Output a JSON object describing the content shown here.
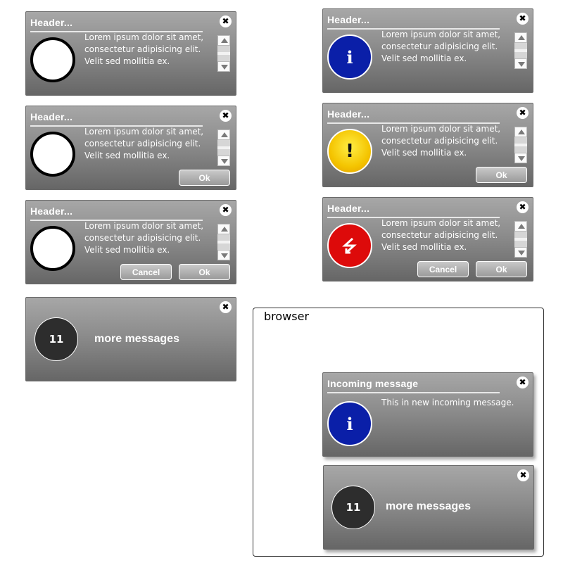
{
  "dialogs": {
    "header": "Header...",
    "close_glyph": "✖",
    "body_lines": [
      "Lorem ipsum dolor sit amet,",
      "consectetur adipisicing elit.",
      "Velit sed mollitia ex."
    ],
    "ok_label": "Ok",
    "cancel_label": "Cancel"
  },
  "icons": {
    "blank": "empty-circle-icon",
    "info": "info-icon",
    "warning": "warning-icon",
    "error": "error-icon",
    "info_glyph": "i",
    "warning_glyph": "!"
  },
  "counter": {
    "count": "11",
    "text": "more messages"
  },
  "browser": {
    "title": "browser",
    "incoming": {
      "header": "Incoming message",
      "text": "This in new incoming message."
    }
  },
  "colors": {
    "info_blue": "#0a1fa8",
    "warning_yellow": "#f4c400",
    "error_red": "#dd0a0a",
    "counter_dark": "#2d2d2d"
  }
}
